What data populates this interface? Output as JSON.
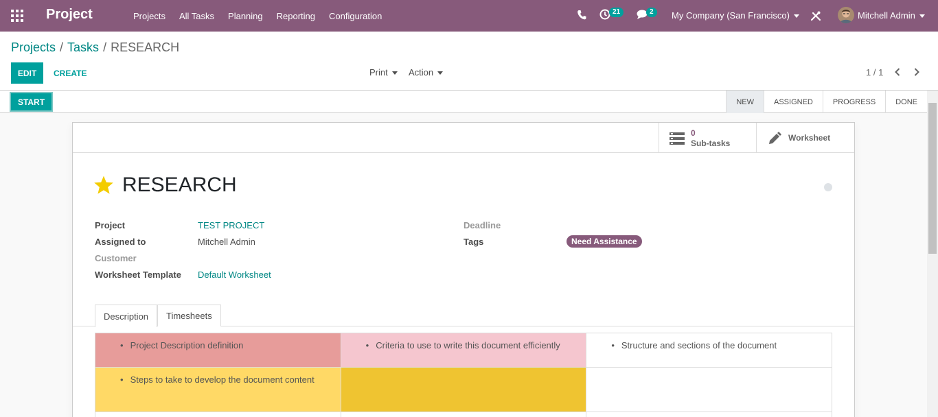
{
  "navbar": {
    "brand": "Project",
    "menu": [
      "Projects",
      "All Tasks",
      "Planning",
      "Reporting",
      "Configuration"
    ],
    "activity_count": "21",
    "message_count": "2",
    "company": "My Company (San Francisco)",
    "user": "Mitchell Admin"
  },
  "breadcrumb": {
    "items": [
      "Projects",
      "Tasks"
    ],
    "current": "RESEARCH",
    "separator": "/"
  },
  "toolbar": {
    "edit_label": "EDIT",
    "create_label": "CREATE",
    "print_label": "Print",
    "action_label": "Action",
    "pager": "1 / 1"
  },
  "statusbar": {
    "start_label": "START",
    "stages": [
      "NEW",
      "ASSIGNED",
      "PROGRESS",
      "DONE"
    ],
    "active_stage": "NEW"
  },
  "smart_buttons": {
    "subtasks_value": "0",
    "subtasks_label": "Sub-tasks",
    "worksheet_label": "Worksheet"
  },
  "task": {
    "title": "RESEARCH",
    "starred": true,
    "fields": {
      "project_label": "Project",
      "project_value": "TEST PROJECT",
      "assigned_label": "Assigned to",
      "assigned_value": "Mitchell Admin",
      "customer_label": "Customer",
      "worksheet_label": "Worksheet Template",
      "worksheet_value": "Default Worksheet",
      "deadline_label": "Deadline",
      "tags_label": "Tags",
      "tag_value": "Need Assistance"
    }
  },
  "tabs": [
    "Description",
    "Timesheets"
  ],
  "description": {
    "cells": [
      [
        "Project Description definition",
        "Criteria to use to write this document efficiently",
        "Structure and sections of the document"
      ],
      [
        "Steps to take to develop the document content",
        "",
        ""
      ]
    ]
  },
  "colors": {
    "brand": "#875a7b",
    "accent": "#00a09d",
    "cell_red": "#e79c9a",
    "cell_pink": "#f5c6cf",
    "cell_yellow": "#ffd966",
    "cell_gold": "#efc431"
  }
}
